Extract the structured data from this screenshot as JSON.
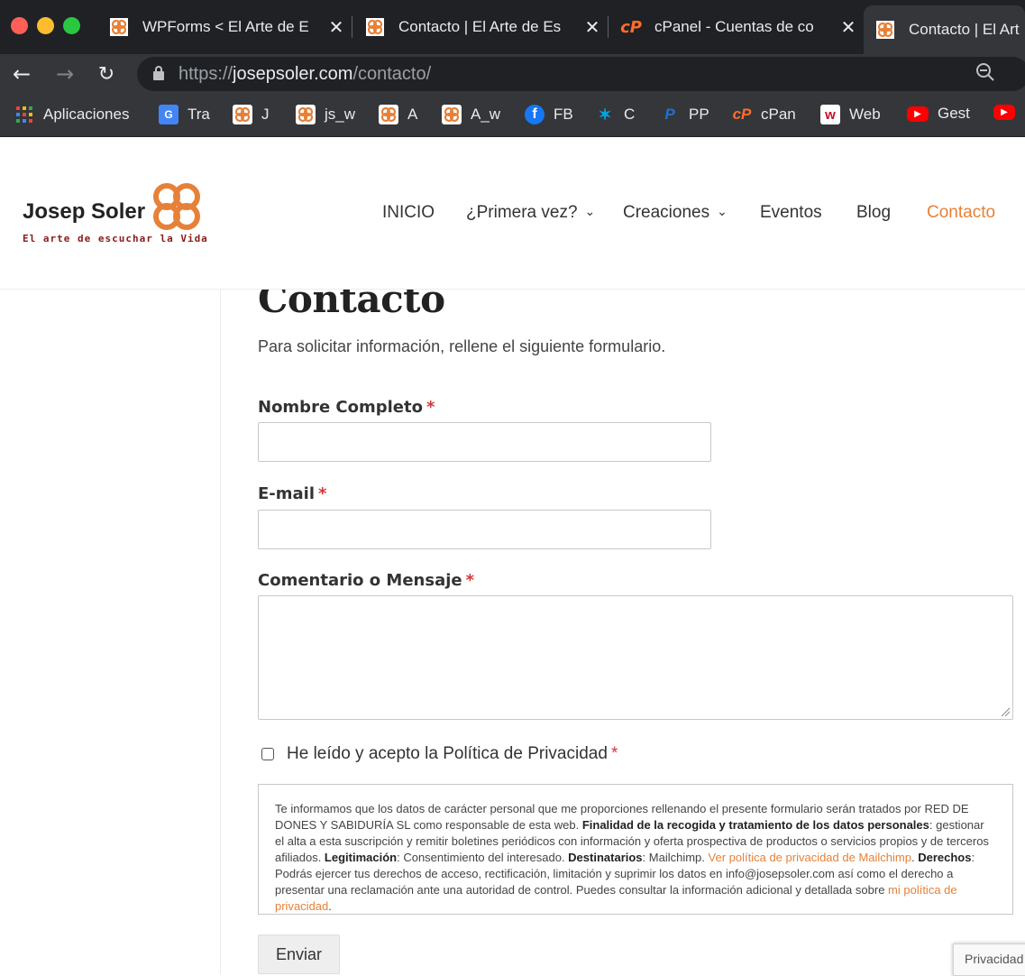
{
  "browser": {
    "tabs": [
      {
        "title": "WPForms < El Arte de E",
        "favicon": "orange-clover-icon",
        "active": false
      },
      {
        "title": "Contacto | El Arte de Es",
        "favicon": "orange-clover-icon",
        "active": false
      },
      {
        "title": "cPanel - Cuentas de co",
        "favicon": "cpanel-icon",
        "active": false
      },
      {
        "title": "Contacto | El Art",
        "favicon": "orange-clover-icon",
        "active": true
      }
    ],
    "close_glyph": "✕",
    "url_scheme": "https://",
    "url_domain": "josepsoler.com",
    "url_path": "/contacto/",
    "bookmarks": [
      {
        "label": "Aplicaciones",
        "icon": "apps-grid-icon"
      },
      {
        "label": "Tra",
        "icon": "google-translate-icon"
      },
      {
        "label": "J",
        "icon": "orange-clover-icon"
      },
      {
        "label": "js_w",
        "icon": "orange-clover-icon"
      },
      {
        "label": "A",
        "icon": "orange-clover-icon"
      },
      {
        "label": "A_w",
        "icon": "orange-clover-icon"
      },
      {
        "label": "FB",
        "icon": "facebook-icon"
      },
      {
        "label": "C",
        "icon": "caixabank-icon"
      },
      {
        "label": "PP",
        "icon": "paypal-icon"
      },
      {
        "label": "cPan",
        "icon": "cpanel-icon"
      },
      {
        "label": "Web",
        "icon": "webempresa-icon"
      },
      {
        "label": "Gest",
        "icon": "youtube-icon"
      }
    ]
  },
  "site": {
    "logo_name": "Josep Soler",
    "logo_tagline": "El arte de escuchar la Vida",
    "brand_color": "#e58139",
    "nav": [
      {
        "label": "INICIO",
        "dropdown": false,
        "active": false
      },
      {
        "label": "¿Primera vez?",
        "dropdown": true,
        "active": false
      },
      {
        "label": "Creaciones",
        "dropdown": true,
        "active": false
      },
      {
        "label": "Eventos",
        "dropdown": false,
        "active": false
      },
      {
        "label": "Blog",
        "dropdown": false,
        "active": false
      },
      {
        "label": "Contacto",
        "dropdown": false,
        "active": true
      }
    ]
  },
  "page": {
    "title": "Contacto",
    "intro": "Para solicitar información, rellene el siguiente formulario."
  },
  "form": {
    "required_mark": "*",
    "name_label": "Nombre Completo",
    "name_value": "",
    "email_label": "E-mail",
    "email_value": "",
    "message_label": "Comentario o Mensaje",
    "message_value": "",
    "privacy_checkbox_label": "He leído y acepto la Política de Privacidad",
    "privacy_checked": false,
    "privacy_text": {
      "p1": "Te informamos que los datos de carácter personal que me proporciones rellenando el presente formulario serán tratados por RED DE DONES Y SABIDURÍA SL como responsable de esta web. ",
      "b1": "Finalidad de la recogida y tratamiento de los datos personales",
      "p2": ": gestionar el alta a esta suscripción y remitir boletines periódicos con información y oferta prospectiva de productos o servicios propios y de terceros afiliados. ",
      "b2": "Legitimación",
      "p3": ": Consentimiento del interesado. ",
      "b3": "Destinatarios",
      "p4": ": Mailchimp. ",
      "link1": "Ver política de privacidad de Mailchimp",
      "p5": ". ",
      "b4": "Derechos",
      "p6": ": Podrás ejercer tus derechos de acceso, rectificación, limitación y suprimir los datos en info@josepsoler.com así como el derecho a presentar una reclamación ante una autoridad de control. Puedes consultar la información adicional y detallada sobre ",
      "link2": "mi política de privacidad",
      "p7": "."
    },
    "submit_label": "Enviar"
  },
  "recaptcha_label": "Privacidad"
}
